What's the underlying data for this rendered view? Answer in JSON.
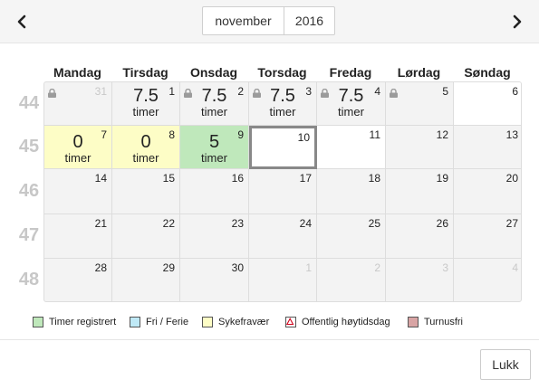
{
  "header": {
    "month": "november",
    "year": "2016",
    "prev_icon": "chevron-left-icon",
    "next_icon": "chevron-right-icon"
  },
  "weekdays": [
    "Mandag",
    "Tirsdag",
    "Onsdag",
    "Torsdag",
    "Fredag",
    "Lørdag",
    "Søndag"
  ],
  "weeks": [
    {
      "number": "44",
      "days": [
        {
          "day": "31",
          "dim": true,
          "locked": true,
          "state": "gray",
          "hours": "",
          "unit": ""
        },
        {
          "day": "1",
          "dim": false,
          "locked": false,
          "state": "gray",
          "hours": "7.5",
          "unit": "timer"
        },
        {
          "day": "2",
          "dim": false,
          "locked": true,
          "state": "gray",
          "hours": "7.5",
          "unit": "timer"
        },
        {
          "day": "3",
          "dim": false,
          "locked": true,
          "state": "gray",
          "hours": "7.5",
          "unit": "timer"
        },
        {
          "day": "4",
          "dim": false,
          "locked": true,
          "state": "gray",
          "hours": "7.5",
          "unit": "timer"
        },
        {
          "day": "5",
          "dim": false,
          "locked": true,
          "state": "gray",
          "hours": "",
          "unit": ""
        },
        {
          "day": "6",
          "dim": false,
          "locked": false,
          "state": "white",
          "hours": "",
          "unit": ""
        }
      ]
    },
    {
      "number": "45",
      "days": [
        {
          "day": "7",
          "dim": false,
          "locked": false,
          "state": "yellow",
          "hours": "0",
          "unit": "timer"
        },
        {
          "day": "8",
          "dim": false,
          "locked": false,
          "state": "yellow",
          "hours": "0",
          "unit": "timer"
        },
        {
          "day": "9",
          "dim": false,
          "locked": false,
          "state": "green",
          "hours": "5",
          "unit": "timer"
        },
        {
          "day": "10",
          "dim": false,
          "locked": false,
          "state": "today",
          "hours": "",
          "unit": ""
        },
        {
          "day": "11",
          "dim": false,
          "locked": false,
          "state": "white",
          "hours": "",
          "unit": ""
        },
        {
          "day": "12",
          "dim": false,
          "locked": false,
          "state": "gray",
          "hours": "",
          "unit": ""
        },
        {
          "day": "13",
          "dim": false,
          "locked": false,
          "state": "gray",
          "hours": "",
          "unit": ""
        }
      ]
    },
    {
      "number": "46",
      "days": [
        {
          "day": "14",
          "dim": false,
          "locked": false,
          "state": "gray",
          "hours": "",
          "unit": ""
        },
        {
          "day": "15",
          "dim": false,
          "locked": false,
          "state": "gray",
          "hours": "",
          "unit": ""
        },
        {
          "day": "16",
          "dim": false,
          "locked": false,
          "state": "gray",
          "hours": "",
          "unit": ""
        },
        {
          "day": "17",
          "dim": false,
          "locked": false,
          "state": "gray",
          "hours": "",
          "unit": ""
        },
        {
          "day": "18",
          "dim": false,
          "locked": false,
          "state": "gray",
          "hours": "",
          "unit": ""
        },
        {
          "day": "19",
          "dim": false,
          "locked": false,
          "state": "gray",
          "hours": "",
          "unit": ""
        },
        {
          "day": "20",
          "dim": false,
          "locked": false,
          "state": "gray",
          "hours": "",
          "unit": ""
        }
      ]
    },
    {
      "number": "47",
      "days": [
        {
          "day": "21",
          "dim": false,
          "locked": false,
          "state": "gray",
          "hours": "",
          "unit": ""
        },
        {
          "day": "22",
          "dim": false,
          "locked": false,
          "state": "gray",
          "hours": "",
          "unit": ""
        },
        {
          "day": "23",
          "dim": false,
          "locked": false,
          "state": "gray",
          "hours": "",
          "unit": ""
        },
        {
          "day": "24",
          "dim": false,
          "locked": false,
          "state": "gray",
          "hours": "",
          "unit": ""
        },
        {
          "day": "25",
          "dim": false,
          "locked": false,
          "state": "gray",
          "hours": "",
          "unit": ""
        },
        {
          "day": "26",
          "dim": false,
          "locked": false,
          "state": "gray",
          "hours": "",
          "unit": ""
        },
        {
          "day": "27",
          "dim": false,
          "locked": false,
          "state": "gray",
          "hours": "",
          "unit": ""
        }
      ]
    },
    {
      "number": "48",
      "days": [
        {
          "day": "28",
          "dim": false,
          "locked": false,
          "state": "gray",
          "hours": "",
          "unit": ""
        },
        {
          "day": "29",
          "dim": false,
          "locked": false,
          "state": "gray",
          "hours": "",
          "unit": ""
        },
        {
          "day": "30",
          "dim": false,
          "locked": false,
          "state": "gray",
          "hours": "",
          "unit": ""
        },
        {
          "day": "1",
          "dim": true,
          "locked": false,
          "state": "gray",
          "hours": "",
          "unit": ""
        },
        {
          "day": "2",
          "dim": true,
          "locked": false,
          "state": "gray",
          "hours": "",
          "unit": ""
        },
        {
          "day": "3",
          "dim": true,
          "locked": false,
          "state": "gray",
          "hours": "",
          "unit": ""
        },
        {
          "day": "4",
          "dim": true,
          "locked": false,
          "state": "gray",
          "hours": "",
          "unit": ""
        }
      ]
    }
  ],
  "legend": [
    {
      "label": "Timer registrert",
      "color": "#bfe8bb",
      "icon": ""
    },
    {
      "label": "Fri / Ferie",
      "color": "#bfe9f6",
      "icon": ""
    },
    {
      "label": "Sykefravær",
      "color": "#fdfdc6",
      "icon": ""
    },
    {
      "label": "Offentlig høytidsdag",
      "color": "#ffffff",
      "icon": "holiday-triangle-icon"
    },
    {
      "label": "Turnusfri",
      "color": "#d8a4a4",
      "icon": ""
    }
  ],
  "footer": {
    "close_label": "Lukk"
  }
}
